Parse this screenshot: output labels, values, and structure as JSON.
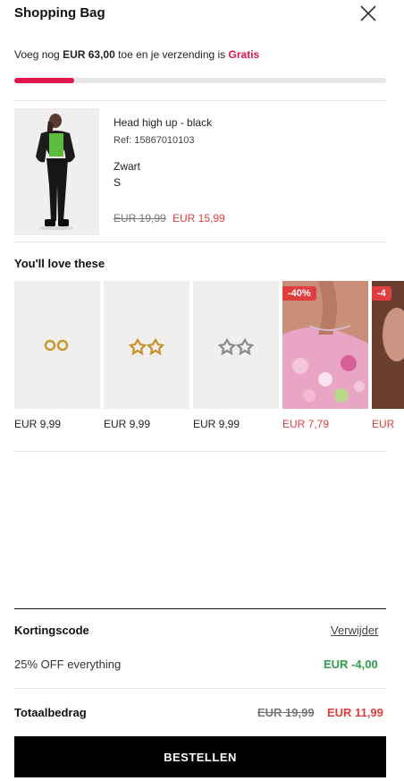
{
  "header": {
    "title": "Shopping Bag",
    "close_icon": "close-icon"
  },
  "shipping": {
    "prefix": "Voeg nog ",
    "amount": "EUR 63,00",
    "middle": " toe en je verzending is ",
    "free_label": "Gratis",
    "progress_fraction": 0.16
  },
  "cart_item": {
    "name": "Head high up - black",
    "ref": "Ref: 15867010103",
    "color": "Zwart",
    "size": "S",
    "old_price": "EUR 19,99",
    "new_price": "EUR 15,99"
  },
  "recommendations": {
    "title": "You'll love these",
    "items": [
      {
        "price": "EUR 9,99",
        "image": "gold-hoop-earrings"
      },
      {
        "price": "EUR 9,99",
        "image": "gold-star-earrings"
      },
      {
        "price": "EUR 9,99",
        "image": "silver-star-earrings"
      },
      {
        "price": "EUR 7,79",
        "badge": "-40%",
        "image": "bracelet-on-wrist"
      },
      {
        "price": "EUR",
        "badge": "-4",
        "image": "model-photo"
      }
    ]
  },
  "discount": {
    "label": "Kortingscode",
    "remove_label": "Verwijder",
    "code_text": "25% OFF everything",
    "value": "EUR -4,00"
  },
  "total": {
    "label": "Totaalbedrag",
    "old_price": "EUR 19,99",
    "new_price": "EUR 11,99"
  },
  "checkout": {
    "button_label": "BESTELLEN"
  },
  "colors": {
    "accent": "#e0184a",
    "sale": "#e03e3e",
    "discount": "#2e9e4c",
    "button": "#000000"
  }
}
